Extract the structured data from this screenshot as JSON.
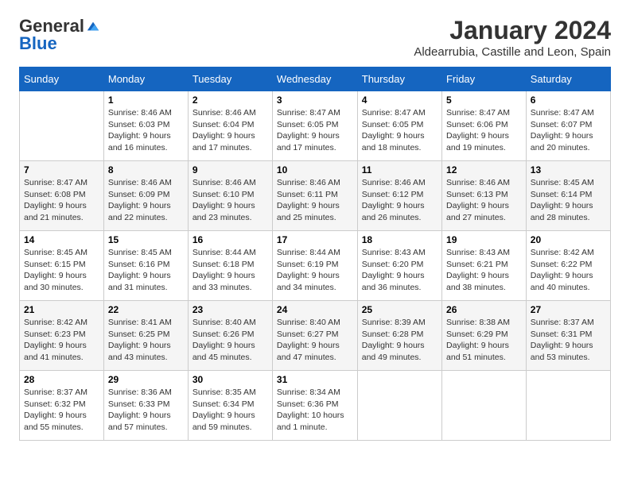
{
  "header": {
    "logo_general": "General",
    "logo_blue": "Blue",
    "month": "January 2024",
    "location": "Aldearrubia, Castille and Leon, Spain"
  },
  "days_of_week": [
    "Sunday",
    "Monday",
    "Tuesday",
    "Wednesday",
    "Thursday",
    "Friday",
    "Saturday"
  ],
  "weeks": [
    [
      {
        "day": "",
        "info": ""
      },
      {
        "day": "1",
        "info": "Sunrise: 8:46 AM\nSunset: 6:03 PM\nDaylight: 9 hours\nand 16 minutes."
      },
      {
        "day": "2",
        "info": "Sunrise: 8:46 AM\nSunset: 6:04 PM\nDaylight: 9 hours\nand 17 minutes."
      },
      {
        "day": "3",
        "info": "Sunrise: 8:47 AM\nSunset: 6:05 PM\nDaylight: 9 hours\nand 17 minutes."
      },
      {
        "day": "4",
        "info": "Sunrise: 8:47 AM\nSunset: 6:05 PM\nDaylight: 9 hours\nand 18 minutes."
      },
      {
        "day": "5",
        "info": "Sunrise: 8:47 AM\nSunset: 6:06 PM\nDaylight: 9 hours\nand 19 minutes."
      },
      {
        "day": "6",
        "info": "Sunrise: 8:47 AM\nSunset: 6:07 PM\nDaylight: 9 hours\nand 20 minutes."
      }
    ],
    [
      {
        "day": "7",
        "info": "Sunrise: 8:47 AM\nSunset: 6:08 PM\nDaylight: 9 hours\nand 21 minutes."
      },
      {
        "day": "8",
        "info": "Sunrise: 8:46 AM\nSunset: 6:09 PM\nDaylight: 9 hours\nand 22 minutes."
      },
      {
        "day": "9",
        "info": "Sunrise: 8:46 AM\nSunset: 6:10 PM\nDaylight: 9 hours\nand 23 minutes."
      },
      {
        "day": "10",
        "info": "Sunrise: 8:46 AM\nSunset: 6:11 PM\nDaylight: 9 hours\nand 25 minutes."
      },
      {
        "day": "11",
        "info": "Sunrise: 8:46 AM\nSunset: 6:12 PM\nDaylight: 9 hours\nand 26 minutes."
      },
      {
        "day": "12",
        "info": "Sunrise: 8:46 AM\nSunset: 6:13 PM\nDaylight: 9 hours\nand 27 minutes."
      },
      {
        "day": "13",
        "info": "Sunrise: 8:45 AM\nSunset: 6:14 PM\nDaylight: 9 hours\nand 28 minutes."
      }
    ],
    [
      {
        "day": "14",
        "info": "Sunrise: 8:45 AM\nSunset: 6:15 PM\nDaylight: 9 hours\nand 30 minutes."
      },
      {
        "day": "15",
        "info": "Sunrise: 8:45 AM\nSunset: 6:16 PM\nDaylight: 9 hours\nand 31 minutes."
      },
      {
        "day": "16",
        "info": "Sunrise: 8:44 AM\nSunset: 6:18 PM\nDaylight: 9 hours\nand 33 minutes."
      },
      {
        "day": "17",
        "info": "Sunrise: 8:44 AM\nSunset: 6:19 PM\nDaylight: 9 hours\nand 34 minutes."
      },
      {
        "day": "18",
        "info": "Sunrise: 8:43 AM\nSunset: 6:20 PM\nDaylight: 9 hours\nand 36 minutes."
      },
      {
        "day": "19",
        "info": "Sunrise: 8:43 AM\nSunset: 6:21 PM\nDaylight: 9 hours\nand 38 minutes."
      },
      {
        "day": "20",
        "info": "Sunrise: 8:42 AM\nSunset: 6:22 PM\nDaylight: 9 hours\nand 40 minutes."
      }
    ],
    [
      {
        "day": "21",
        "info": "Sunrise: 8:42 AM\nSunset: 6:23 PM\nDaylight: 9 hours\nand 41 minutes."
      },
      {
        "day": "22",
        "info": "Sunrise: 8:41 AM\nSunset: 6:25 PM\nDaylight: 9 hours\nand 43 minutes."
      },
      {
        "day": "23",
        "info": "Sunrise: 8:40 AM\nSunset: 6:26 PM\nDaylight: 9 hours\nand 45 minutes."
      },
      {
        "day": "24",
        "info": "Sunrise: 8:40 AM\nSunset: 6:27 PM\nDaylight: 9 hours\nand 47 minutes."
      },
      {
        "day": "25",
        "info": "Sunrise: 8:39 AM\nSunset: 6:28 PM\nDaylight: 9 hours\nand 49 minutes."
      },
      {
        "day": "26",
        "info": "Sunrise: 8:38 AM\nSunset: 6:29 PM\nDaylight: 9 hours\nand 51 minutes."
      },
      {
        "day": "27",
        "info": "Sunrise: 8:37 AM\nSunset: 6:31 PM\nDaylight: 9 hours\nand 53 minutes."
      }
    ],
    [
      {
        "day": "28",
        "info": "Sunrise: 8:37 AM\nSunset: 6:32 PM\nDaylight: 9 hours\nand 55 minutes."
      },
      {
        "day": "29",
        "info": "Sunrise: 8:36 AM\nSunset: 6:33 PM\nDaylight: 9 hours\nand 57 minutes."
      },
      {
        "day": "30",
        "info": "Sunrise: 8:35 AM\nSunset: 6:34 PM\nDaylight: 9 hours\nand 59 minutes."
      },
      {
        "day": "31",
        "info": "Sunrise: 8:34 AM\nSunset: 6:36 PM\nDaylight: 10 hours\nand 1 minute."
      },
      {
        "day": "",
        "info": ""
      },
      {
        "day": "",
        "info": ""
      },
      {
        "day": "",
        "info": ""
      }
    ]
  ]
}
